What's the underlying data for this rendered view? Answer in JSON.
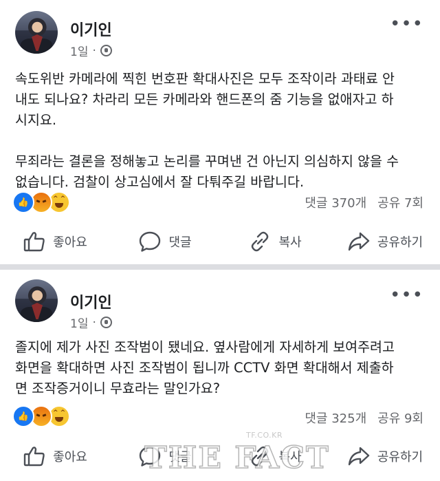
{
  "posts": [
    {
      "author": "이기인",
      "time": "1일",
      "body": [
        "속도위반 카메라에 찍힌 번호판 확대사진은 모두 조작이라 과태료 안",
        "내도 되나요? 차라리 모든 카메라와 핸드폰의 줌 기능을 없애자고 하",
        "시지요.",
        "",
        "무죄라는 결론을 정해놓고 논리를 꾸며낸 건 아닌지 의심하지 않을 수",
        "없습니다. 검찰이 상고심에서 잘 다퉈주길 바랍니다."
      ],
      "comments": "댓글 370개",
      "shares": "공유 7회"
    },
    {
      "author": "이기인",
      "time": "1일",
      "body": [
        "졸지에 제가 사진 조작범이 됐네요. 옆사람에게 자세하게 보여주려고",
        "화면을 확대하면 사진 조작범이 됩니까 CCTV 화면 확대해서 제출하",
        "면 조작증거이니 무효라는 말인가요?"
      ],
      "comments": "댓글 325개",
      "shares": "공유 9회"
    }
  ],
  "actions": {
    "like": "좋아요",
    "comment": "댓글",
    "copy": "복사",
    "share": "공유하기"
  },
  "icons": {
    "more": "more-dots-icon",
    "privacy": "globe-icon",
    "like": "thumbs-up-icon",
    "comment": "speech-bubble-icon",
    "copy": "link-icon",
    "share": "share-arrow-icon"
  },
  "reactions": [
    "like",
    "angry",
    "haha"
  ],
  "watermark": {
    "small": "TF.CO.KR",
    "large": "THE FACT"
  },
  "colors": {
    "like_blue": "#1877f2",
    "meta_gray": "#65676b",
    "divider": "#dcdde1"
  }
}
